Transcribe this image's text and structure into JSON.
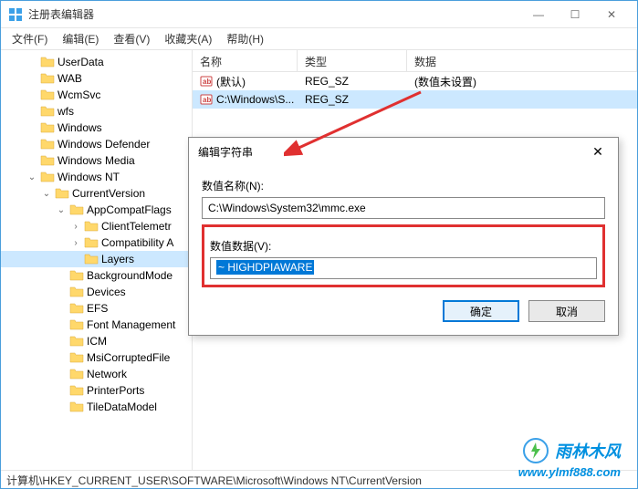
{
  "window": {
    "title": "注册表编辑器"
  },
  "win_controls": {
    "min": "—",
    "max": "☐",
    "close": "✕"
  },
  "menu": {
    "file": "文件(F)",
    "edit": "编辑(E)",
    "view": "查看(V)",
    "favorites": "收藏夹(A)",
    "help": "帮助(H)"
  },
  "tree": {
    "items": [
      {
        "indent": 28,
        "exp": "",
        "label": "UserData"
      },
      {
        "indent": 28,
        "exp": "",
        "label": "WAB"
      },
      {
        "indent": 28,
        "exp": "",
        "label": "WcmSvc"
      },
      {
        "indent": 28,
        "exp": "",
        "label": "wfs"
      },
      {
        "indent": 28,
        "exp": "",
        "label": "Windows"
      },
      {
        "indent": 28,
        "exp": "",
        "label": "Windows Defender"
      },
      {
        "indent": 28,
        "exp": "",
        "label": "Windows Media"
      },
      {
        "indent": 28,
        "exp": "v",
        "label": "Windows NT"
      },
      {
        "indent": 44,
        "exp": "v",
        "label": "CurrentVersion"
      },
      {
        "indent": 60,
        "exp": "v",
        "label": "AppCompatFlags"
      },
      {
        "indent": 76,
        "exp": ">",
        "label": "ClientTelemetr"
      },
      {
        "indent": 76,
        "exp": ">",
        "label": "Compatibility A"
      },
      {
        "indent": 76,
        "exp": "",
        "label": "Layers",
        "selected": true
      },
      {
        "indent": 60,
        "exp": "",
        "label": "BackgroundMode"
      },
      {
        "indent": 60,
        "exp": "",
        "label": "Devices"
      },
      {
        "indent": 60,
        "exp": "",
        "label": "EFS"
      },
      {
        "indent": 60,
        "exp": "",
        "label": "Font Management"
      },
      {
        "indent": 60,
        "exp": "",
        "label": "ICM"
      },
      {
        "indent": 60,
        "exp": "",
        "label": "MsiCorruptedFile"
      },
      {
        "indent": 60,
        "exp": "",
        "label": "Network"
      },
      {
        "indent": 60,
        "exp": "",
        "label": "PrinterPorts"
      },
      {
        "indent": 60,
        "exp": "",
        "label": "TileDataModel"
      }
    ]
  },
  "list": {
    "headers": {
      "name": "名称",
      "type": "类型",
      "data": "数据"
    },
    "rows": [
      {
        "name": "(默认)",
        "type": "REG_SZ",
        "data": "(数值未设置)",
        "selected": false
      },
      {
        "name": "C:\\Windows\\S...",
        "type": "REG_SZ",
        "data": "",
        "selected": true
      }
    ]
  },
  "dialog": {
    "title": "编辑字符串",
    "close": "✕",
    "name_label": "数值名称(N):",
    "name_value": "C:\\Windows\\System32\\mmc.exe",
    "data_label": "数值数据(V):",
    "data_value": "~ HIGHDPIAWARE",
    "ok": "确定",
    "cancel": "取消"
  },
  "statusbar": "计算机\\HKEY_CURRENT_USER\\SOFTWARE\\Microsoft\\Windows NT\\CurrentVersion",
  "watermark": {
    "text": "雨林木风",
    "url": "www.ylmf888.com"
  }
}
